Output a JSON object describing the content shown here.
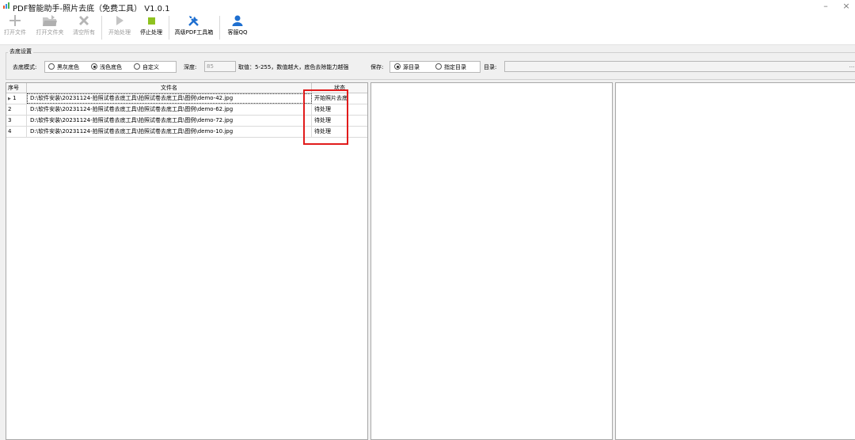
{
  "window": {
    "title": "PDF智能助手-照片去底（免费工具） V1.0.1",
    "minimize_glyph": "–",
    "close_glyph": "×"
  },
  "toolbar": {
    "buttons": [
      {
        "label": "打开文件",
        "icon": "plus-icon",
        "enabled": false
      },
      {
        "label": "打开文件夹",
        "icon": "folder-open-icon",
        "enabled": false
      },
      {
        "label": "清空所有",
        "icon": "clear-x-icon",
        "enabled": false
      },
      {
        "label": "开始处理",
        "icon": "play-icon",
        "enabled": false
      },
      {
        "label": "停止处理",
        "icon": "stop-icon",
        "enabled": true
      },
      {
        "label": "高级PDF工具箱",
        "icon": "tools-icon",
        "enabled": true
      },
      {
        "label": "客服QQ",
        "icon": "user-icon",
        "enabled": true
      }
    ]
  },
  "settings": {
    "group_title": "去底设置",
    "mode_label": "去底模式:",
    "modes": [
      "黑灰底色",
      "浅色底色",
      "自定义"
    ],
    "selected_mode": "浅色底色",
    "depth_label": "深度:",
    "depth_value": "85",
    "hint": "取值：5-255，数值越大，底色去除能力越强",
    "save_label": "保存:",
    "save_options": [
      "源目录",
      "指定目录"
    ],
    "selected_save": "源目录",
    "dir_label": "目录:",
    "dir_value": "",
    "browse_label": "..."
  },
  "file_list": {
    "columns": [
      "序号",
      "文件名",
      "状态"
    ],
    "rows": [
      {
        "index": "1",
        "file": "D:\\软件安装\\20231124-拍照试卷去底工具\\拍照试卷去底工具\\图例\\demo-42.jpg",
        "status": "开始照片去底",
        "current": true
      },
      {
        "index": "2",
        "file": "D:\\软件安装\\20231124-拍照试卷去底工具\\拍照试卷去底工具\\图例\\demo-62.jpg",
        "status": "待处理",
        "current": false
      },
      {
        "index": "3",
        "file": "D:\\软件安装\\20231124-拍照试卷去底工具\\拍照试卷去底工具\\图例\\demo-72.jpg",
        "status": "待处理",
        "current": false
      },
      {
        "index": "4",
        "file": "D:\\软件安装\\20231124-拍照试卷去底工具\\拍照试卷去底工具\\图例\\demo-10.jpg",
        "status": "待处理",
        "current": false
      }
    ]
  },
  "colors": {
    "accent_blue": "#1e6fd0",
    "stop_green": "#8ec21f",
    "highlight_red": "#e11b1b"
  }
}
